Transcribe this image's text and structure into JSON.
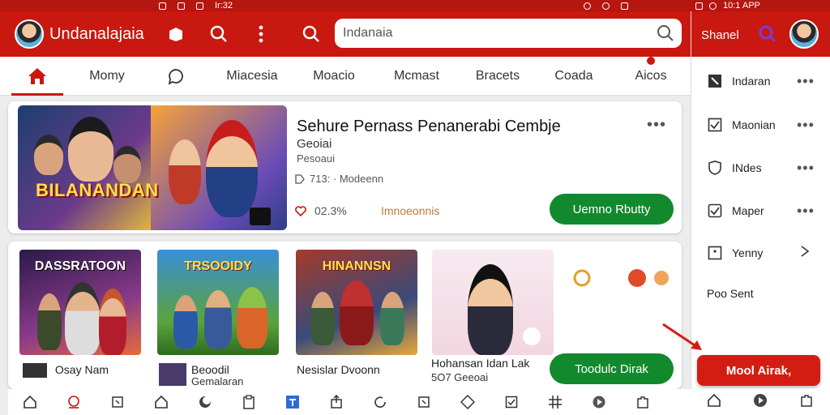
{
  "status_bar": {
    "time": "Ir:32",
    "right_text": "10:1 APP"
  },
  "app": {
    "title": "Undanalajaia",
    "search_value": "Indanaia",
    "colors": {
      "brand": "#c8180f",
      "accent": "#13892e"
    }
  },
  "tabs": [
    {
      "label": "",
      "icon": "home-icon",
      "active": true
    },
    {
      "label": "Momy"
    },
    {
      "label": "",
      "icon": "chat-icon"
    },
    {
      "label": "Miacesia"
    },
    {
      "label": "Moacio"
    },
    {
      "label": "Mcmast"
    },
    {
      "label": "Bracets"
    },
    {
      "label": "Coada"
    },
    {
      "label": "Aicos",
      "badge": true
    }
  ],
  "feature": {
    "banner_title": "BILANANDAN",
    "title": "Sehure Pernass Penanerabi Cembje",
    "subtitle": "Geoiai",
    "subtitle2": "Pesoaui",
    "meta": "713: · Modeenn",
    "rating": "02.3%",
    "extra": "Imnoeonnis",
    "button": "Uemno Rbutty"
  },
  "games": [
    {
      "thumb_title": "DASSRATOON",
      "name": "Osay Nam",
      "sub": ""
    },
    {
      "thumb_title": "TRSOOIDY",
      "name": "Beoodil",
      "sub": "Gemalaran"
    },
    {
      "thumb_title": "HINANNSN",
      "name": "Nesislar Dvoonn",
      "sub": ""
    },
    {
      "thumb_title": "",
      "name": "Hohansan Idan Lak",
      "sub": "5O7 Geeoai"
    }
  ],
  "grid_button": "Toodulc Dirak",
  "panel": {
    "title": "Shanel",
    "items": [
      {
        "label": "Indaran",
        "icon": "expand-icon",
        "trail": "more"
      },
      {
        "label": "Maonian",
        "icon": "checkbox-icon",
        "trail": "more"
      },
      {
        "label": "INdes",
        "icon": "shield-icon",
        "trail": "more"
      },
      {
        "label": "Maper",
        "icon": "check-square-icon",
        "trail": "more"
      },
      {
        "label": "Yenny",
        "icon": "square-dot-icon",
        "trail": "arrow"
      }
    ],
    "plain_item": "Poo Sent",
    "cta": "Mool Airak,"
  }
}
